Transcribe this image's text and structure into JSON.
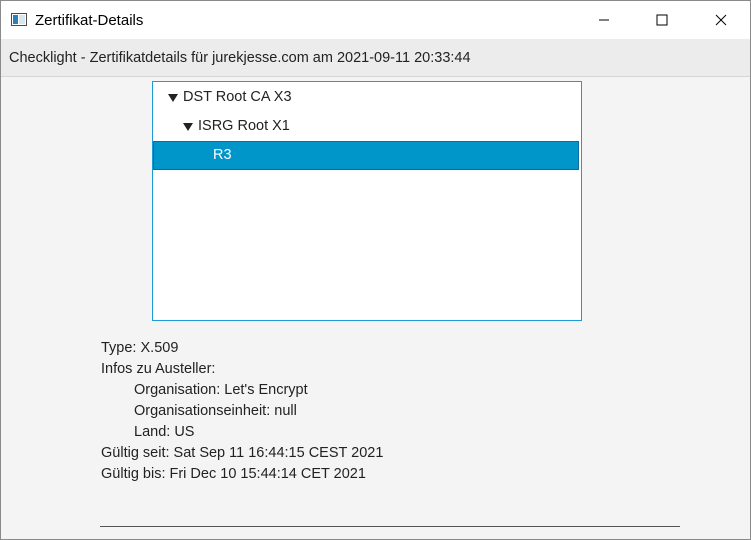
{
  "window": {
    "title": "Zertifikat-Details",
    "icon": "app-window-icon",
    "controls": {
      "minimize": "minimize-icon",
      "maximize": "maximize-icon",
      "close": "close-icon"
    }
  },
  "header": {
    "text": "Checklight - Zertifikatdetails für jurekjesse.com am 2021-09-11 20:33:44"
  },
  "tree": {
    "items": [
      {
        "label": "DST Root CA X3",
        "expanded": true,
        "selected": false
      },
      {
        "label": "ISRG Root X1",
        "expanded": true,
        "selected": false
      },
      {
        "label": "R3",
        "expanded": false,
        "selected": true
      }
    ],
    "selection_color": "#0096c9",
    "border_color": "#1e9bd7"
  },
  "details": {
    "type": "Type: X.509",
    "issuer_heading": "Infos zu Austeller:",
    "organisation": "Organisation: Let's Encrypt",
    "organisation_unit": "Organisationseinheit: null",
    "country": "Land: US",
    "valid_from": "Gültig seit: Sat Sep 11 16:44:15 CEST 2021",
    "valid_until": "Gültig bis: Fri Dec 10 15:44:14 CET 2021"
  }
}
